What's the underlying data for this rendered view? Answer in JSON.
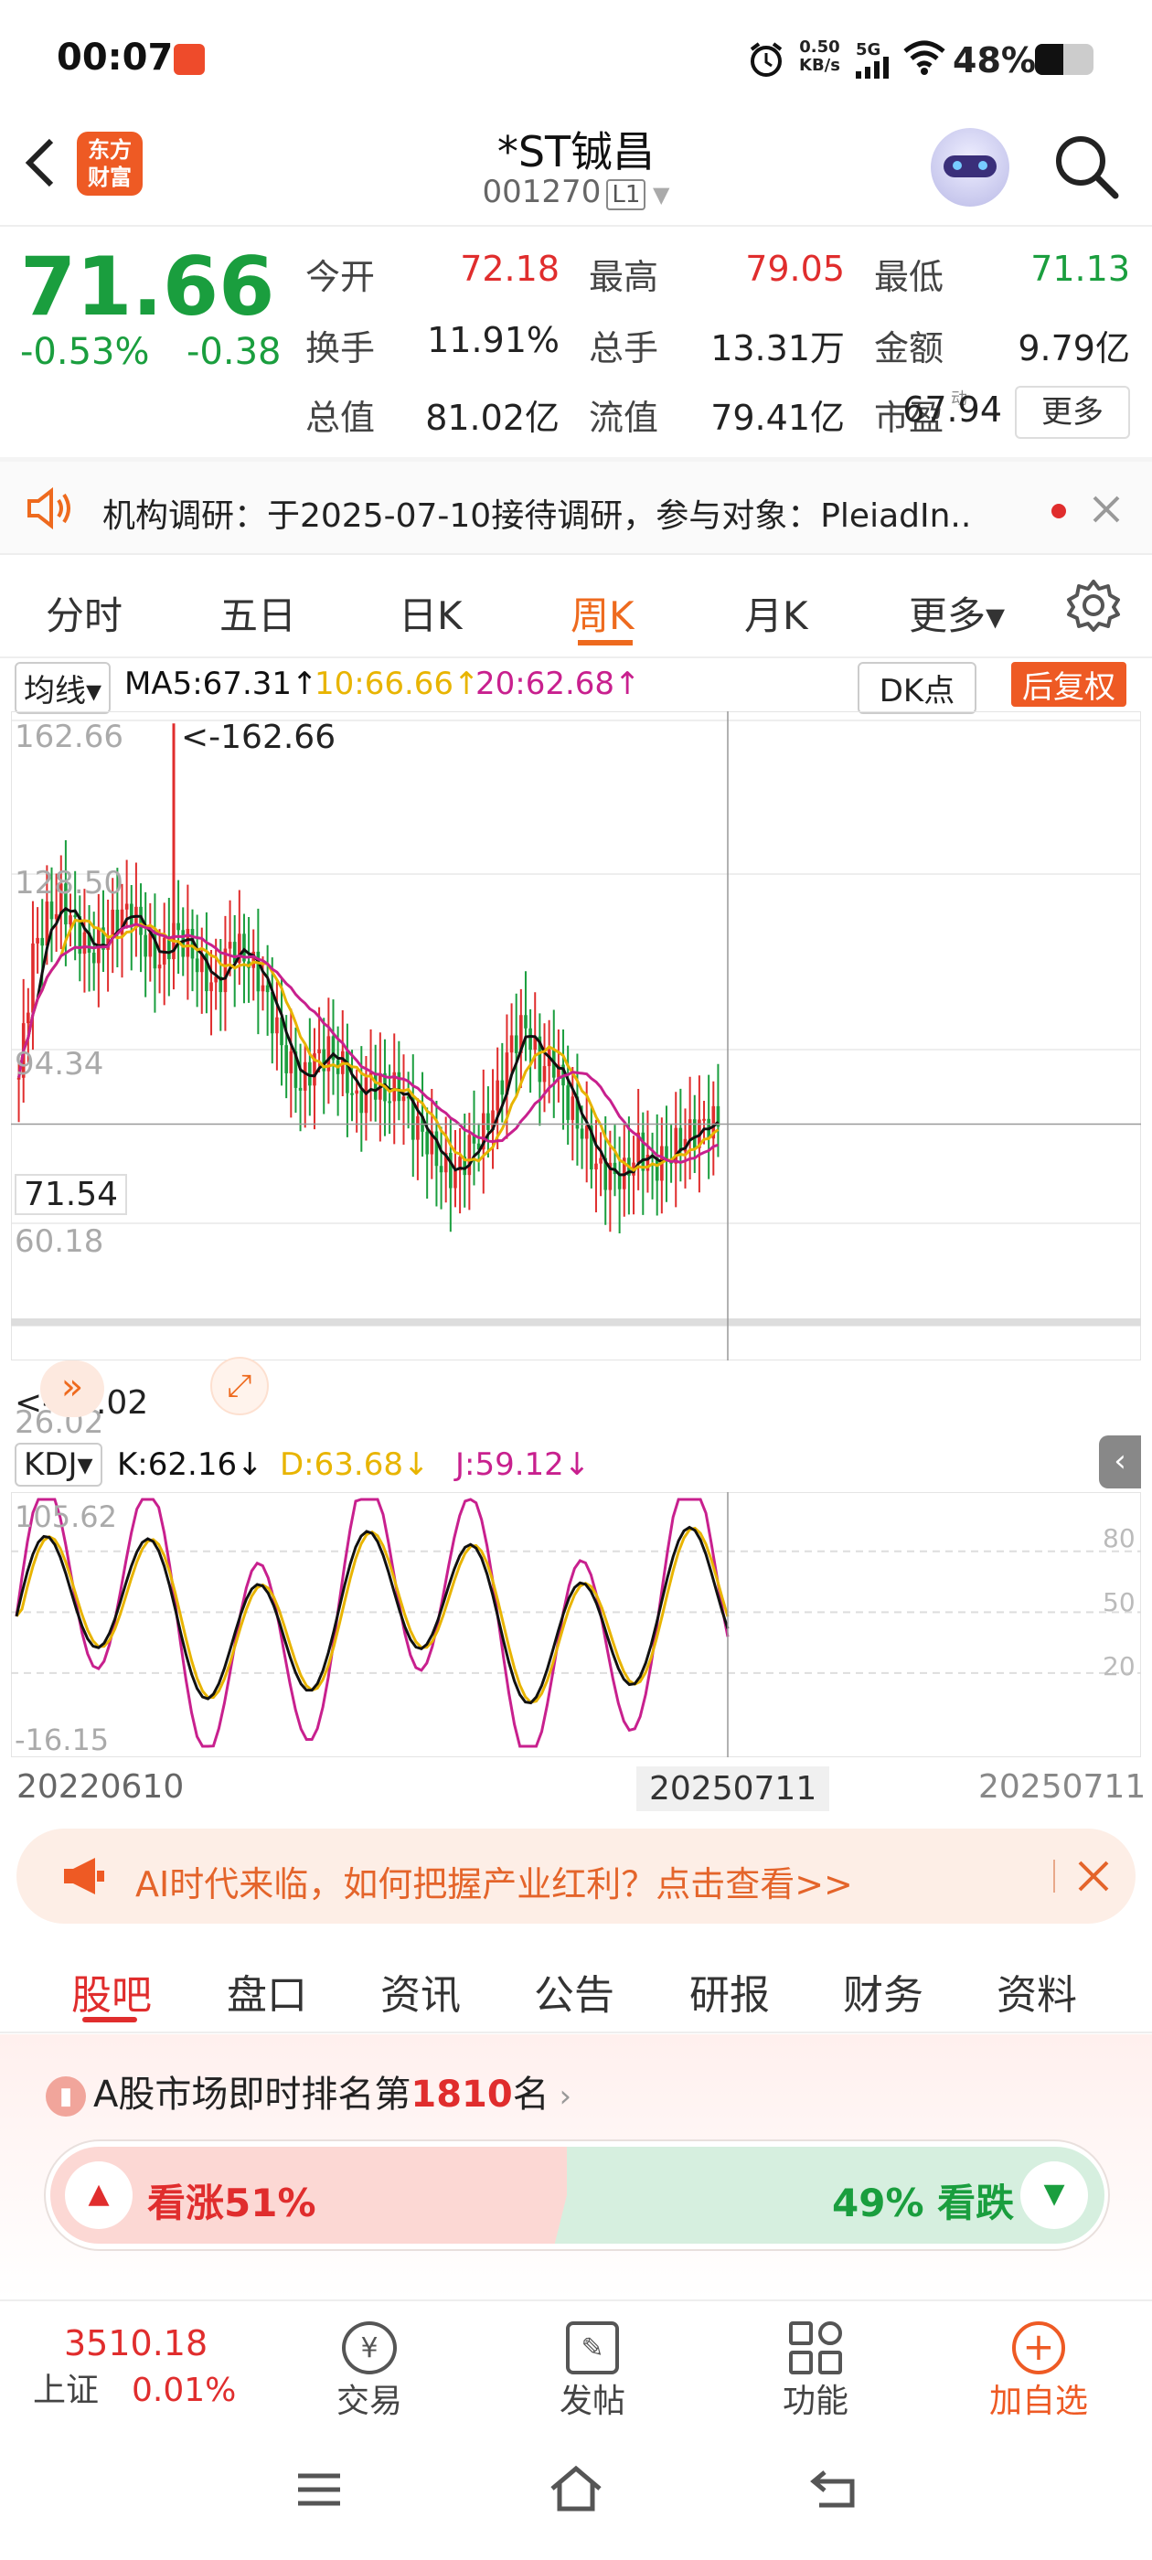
{
  "status_bar": {
    "time": "00:07",
    "net_speed_top": "0.50",
    "net_speed_bottom": "KB/s",
    "network": "5G",
    "battery": "48%"
  },
  "header": {
    "title": "*ST铖昌",
    "code": "001270",
    "level": "L1",
    "logo_top": "东方",
    "logo_bottom": "财富"
  },
  "quote": {
    "price": "71.66",
    "change_pct": "-0.53%",
    "change": "-0.38",
    "rows": [
      [
        {
          "label": "今开",
          "value": "72.18",
          "color": "red"
        },
        {
          "label": "最高",
          "value": "79.05",
          "color": "red"
        },
        {
          "label": "最低",
          "value": "71.13",
          "color": "green"
        }
      ],
      [
        {
          "label": "换手",
          "value": "11.91%",
          "color": "dark"
        },
        {
          "label": "总手",
          "value": "13.31万",
          "color": "dark"
        },
        {
          "label": "金额",
          "value": "9.79亿",
          "color": "dark"
        }
      ],
      [
        {
          "label": "总值",
          "value": "81.02亿",
          "color": "dark"
        },
        {
          "label": "流值",
          "value": "79.41亿",
          "color": "dark"
        },
        {
          "label": "市盈",
          "value": "67.94",
          "color": "dark",
          "sup": "动"
        }
      ]
    ],
    "more": "更多"
  },
  "notice": {
    "text": "机构调研：于2025-07-10接待调研，参与对象：PleiadIn.."
  },
  "chart_tabs": [
    {
      "label": "分时"
    },
    {
      "label": "五日"
    },
    {
      "label": "日K"
    },
    {
      "label": "周K",
      "active": true
    },
    {
      "label": "月K"
    },
    {
      "label": "更多▾"
    }
  ],
  "kline_legend": {
    "selector": "均线▾",
    "ma5": "MA5:67.31↑",
    "ma10": "10:66.66↑",
    "ma20": "20:62.68↑",
    "dk": "DK点",
    "adjust": "后复权"
  },
  "kline_axis": {
    "y1": "162.66",
    "y2": "128.50",
    "y3": "94.34",
    "y4": "60.18",
    "y5": "26.02",
    "max_label": "<-162.66",
    "min_label": "<-26.02",
    "current": "71.54"
  },
  "kdj_legend": {
    "selector": "KDJ▾",
    "k": "K:62.16↓",
    "d": "D:63.68↓",
    "j": "J:59.12↓"
  },
  "kdj_axis": {
    "top": "105.62",
    "bottom": "-16.15",
    "r80": "80",
    "r50": "50",
    "r20": "20"
  },
  "dates": {
    "start": "20220610",
    "cursor": "20250711",
    "end": "20250711"
  },
  "colors": {
    "up": "#e02d2d",
    "down": "#1a9e3e",
    "accent": "#ee6a1e",
    "ma5": "#111111",
    "ma10": "#e8b400",
    "ma20": "#c8208e"
  },
  "chart_data": {
    "type": "candlestick",
    "period": "weekly",
    "ylim": [
      26.02,
      162.66
    ],
    "close_series_approx": [
      82,
      110,
      118,
      122,
      116,
      110,
      113,
      118,
      120,
      112,
      108,
      115,
      112,
      106,
      102,
      112,
      110,
      105,
      96,
      86,
      80,
      86,
      88,
      84,
      76,
      82,
      78,
      80,
      72,
      68,
      62,
      60,
      66,
      70,
      78,
      90,
      94,
      84,
      86,
      76,
      70,
      62,
      60,
      60,
      66,
      62,
      64,
      68,
      70,
      72
    ],
    "kdj": {
      "ylim": [
        -16.15,
        105.62
      ],
      "k_last": 62.16,
      "d_last": 63.68,
      "j_last": 59.12
    }
  },
  "ad": {
    "text": "AI时代来临，如何把握产业红利？点击查看>>"
  },
  "bottom_tabs": [
    {
      "label": "股吧",
      "active": true
    },
    {
      "label": "盘口"
    },
    {
      "label": "资讯"
    },
    {
      "label": "公告"
    },
    {
      "label": "研报"
    },
    {
      "label": "财务"
    },
    {
      "label": "资料"
    }
  ],
  "ranking": {
    "prefix": "A股市场即时排名第",
    "rank": "1810",
    "suffix": "名",
    "bull": "看涨51%",
    "bear": "49% 看跌"
  },
  "toolbar": {
    "index_value": "3510.18",
    "index_name": "上证",
    "index_change": "0.01%",
    "trade": "交易",
    "post": "发帖",
    "func": "功能",
    "add": "加自选"
  }
}
